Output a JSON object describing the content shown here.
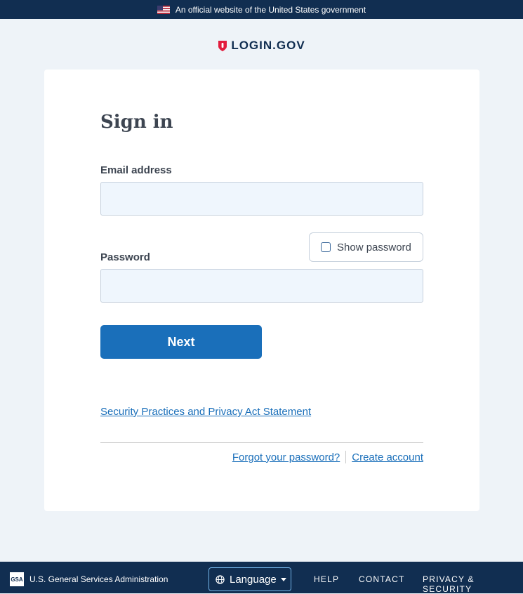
{
  "gov_banner": {
    "text": "An official website of the United States government",
    "flag_icon": "us-flag-icon"
  },
  "brand": {
    "logo_text": "LOGIN.GOV",
    "logo_icon": "shield-icon",
    "color": "#112e51",
    "accent": "#e21c3d"
  },
  "form": {
    "title": "Sign in",
    "email_label": "Email address",
    "email_value": "",
    "password_label": "Password",
    "password_value": "",
    "show_password_label": "Show password",
    "show_password_checked": false,
    "submit_label": "Next",
    "submit_color": "#1a6fba",
    "security_link": "Security Practices and Privacy Act Statement",
    "forgot_link": "Forgot your password?",
    "create_link": "Create account"
  },
  "footer": {
    "agency_logo_text": "GSA",
    "agency": "U.S. General Services Administration",
    "language_label": "Language",
    "language_icon": "globe-icon",
    "links": [
      "HELP",
      "CONTACT",
      "PRIVACY & SECURITY"
    ]
  }
}
